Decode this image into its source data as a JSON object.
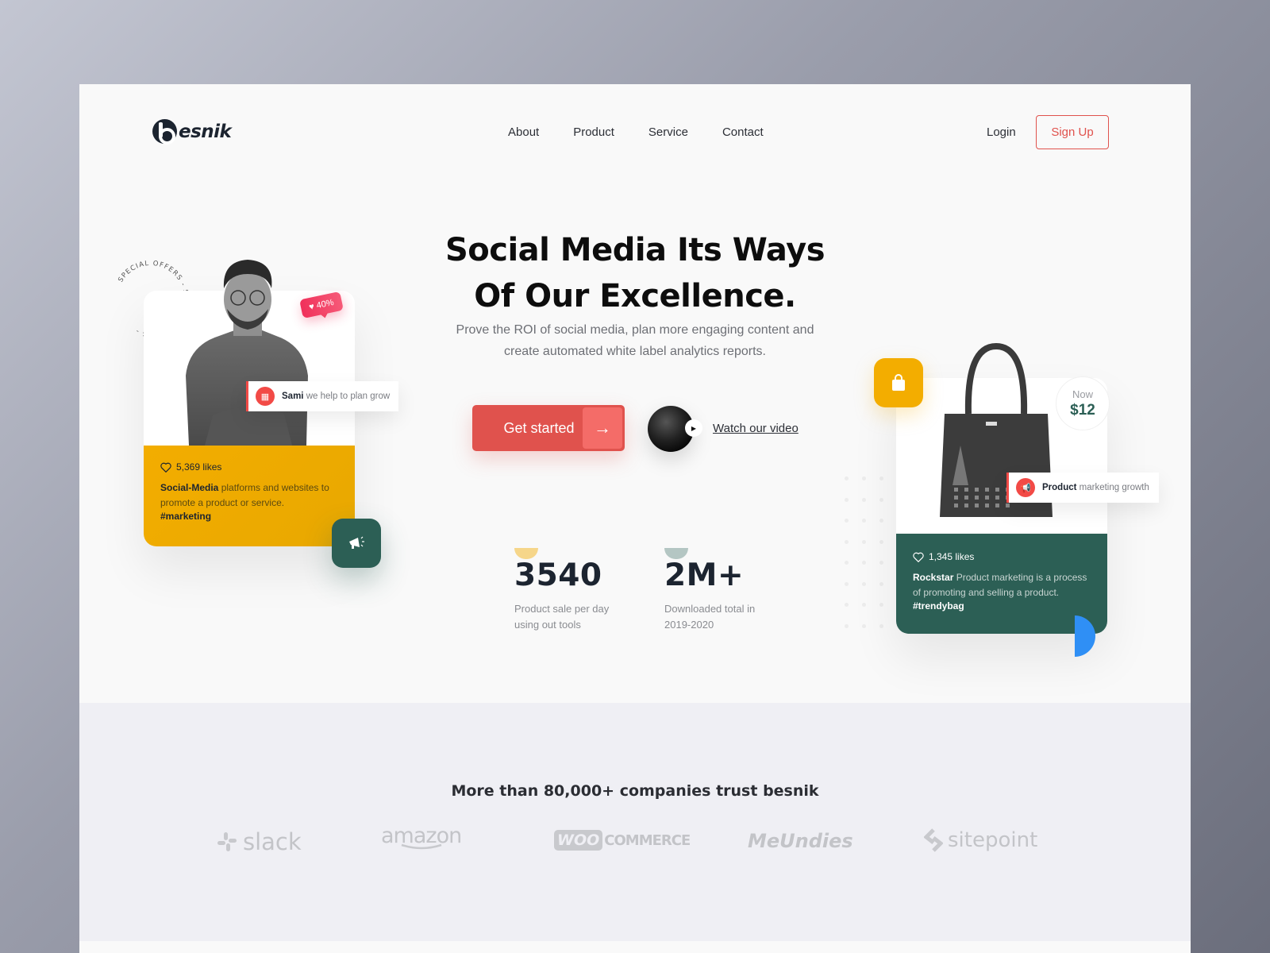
{
  "brand": {
    "name": "esnik",
    "mark": "b"
  },
  "nav": {
    "items": [
      "About",
      "Product",
      "Service",
      "Contact"
    ],
    "login": "Login",
    "signup": "Sign Up"
  },
  "hero": {
    "title_line1": "Social Media Its Ways",
    "title_line2": "Of Our Excellence.",
    "subtitle": "Prove the ROI of social media, plan more engaging content and create automated white label analytics reports.",
    "cta": "Get started",
    "cta_arrow": "→",
    "watch_video": "Watch our video"
  },
  "stats": [
    {
      "value": "3540",
      "label": "Product sale per day using out tools",
      "color": "#f6d68a"
    },
    {
      "value": "2M+",
      "label": "Downloaded total in 2019-2020",
      "color": "#b4c6c3"
    }
  ],
  "left_card": {
    "ring_text": "SPECIAL OFFERS - SPECIAL OFFERS - ",
    "badge": "40%",
    "toast_name": "Sami",
    "toast_text": "we help to plan grow",
    "likes": "5,369 likes",
    "desc_bold": "Social-Media",
    "desc_text": " platforms and websites to promote a product or service.",
    "tag": "#marketing",
    "accent": "#f3ad00"
  },
  "right_card": {
    "price_label": "Now",
    "price": "$12",
    "toast_name": "Product",
    "toast_text": "marketing growth",
    "likes": "1,345 likes",
    "desc_bold": "Rockstar",
    "desc_text": " Product marketing is a process of promoting and selling a product.",
    "tag": "#trendybag",
    "accent": "#2c5f55"
  },
  "trust": {
    "title": "More than 80,000+ companies trust besnik",
    "logos": [
      "slack",
      "amazon",
      "WOO",
      "COMMERCE",
      "MeUndies",
      "sitepoint"
    ]
  },
  "colors": {
    "primary": "#e0524d",
    "yellow": "#f3ad00",
    "green": "#2c5f55",
    "blue": "#2f8ff5"
  }
}
